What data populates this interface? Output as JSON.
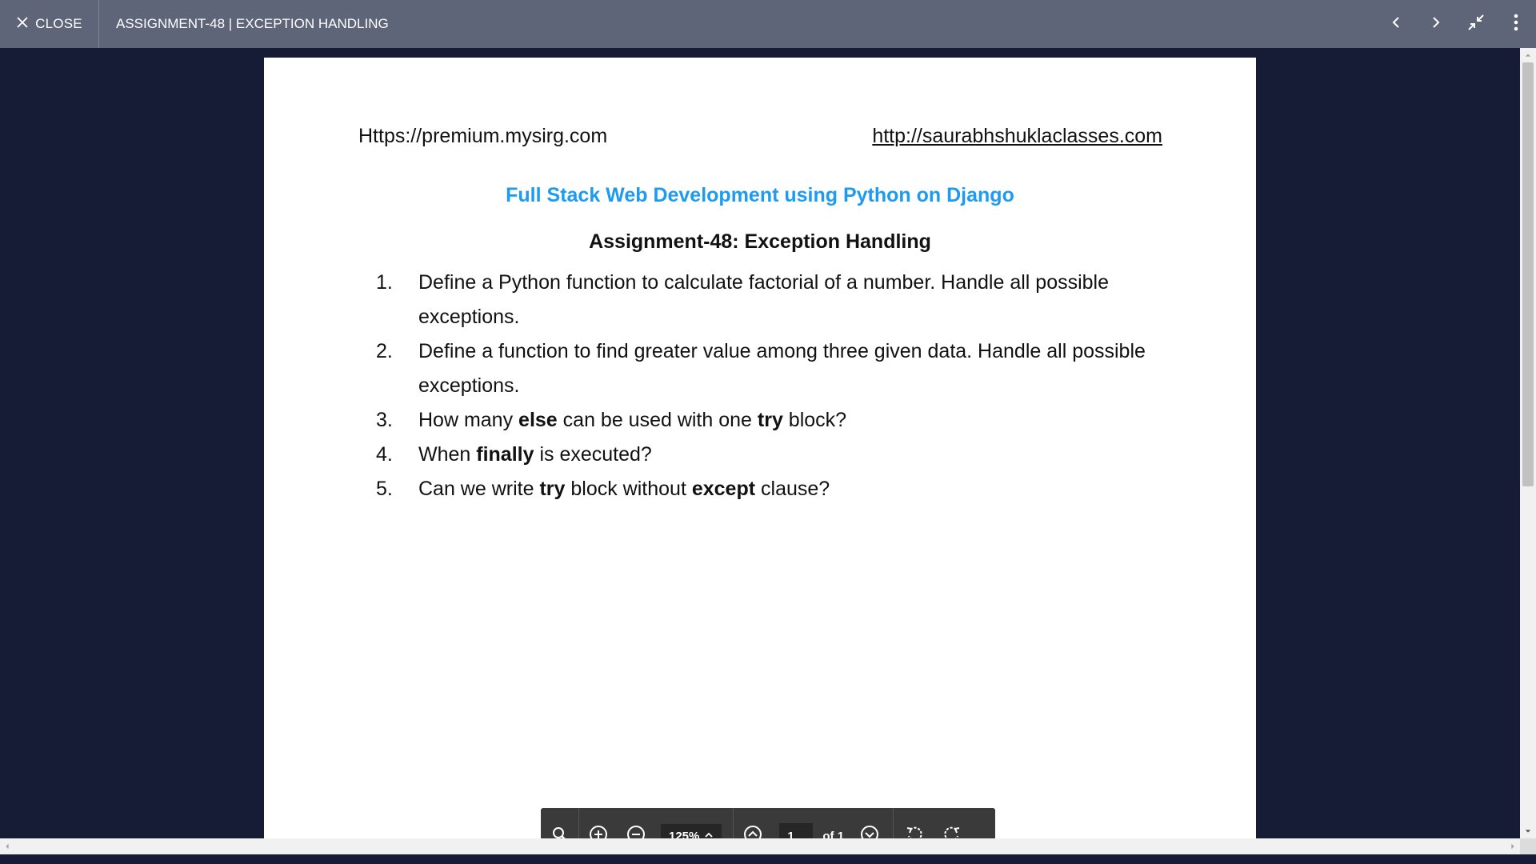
{
  "topbar": {
    "close_label": "CLOSE",
    "title": "ASSIGNMENT-48 | EXCEPTION HANDLING",
    "icons": [
      "chevron-left-icon",
      "chevron-right-icon",
      "minimize-icon",
      "more-vertical-icon"
    ]
  },
  "document": {
    "header_left": "Https://premium.mysirg.com",
    "header_right": "http://saurabhshuklaclasses.com",
    "course_title": "Full Stack Web Development using Python on Django",
    "assignment_title": "Assignment-48: Exception Handling",
    "questions": [
      {
        "num": "1.",
        "parts": [
          {
            "t": "Define a Python function to calculate factorial of a number. Handle all possible exceptions.",
            "b": false
          }
        ]
      },
      {
        "num": "2.",
        "parts": [
          {
            "t": "Define a function to find greater value among three given data. Handle all possible exceptions.",
            "b": false
          }
        ]
      },
      {
        "num": "3.",
        "parts": [
          {
            "t": "How many ",
            "b": false
          },
          {
            "t": "else",
            "b": true
          },
          {
            "t": " can be used with one ",
            "b": false
          },
          {
            "t": "try",
            "b": true
          },
          {
            "t": " block?",
            "b": false
          }
        ]
      },
      {
        "num": "4.",
        "parts": [
          {
            "t": "When ",
            "b": false
          },
          {
            "t": "finally",
            "b": true
          },
          {
            "t": " is executed?",
            "b": false
          }
        ]
      },
      {
        "num": "5.",
        "parts": [
          {
            "t": "Can we write ",
            "b": false
          },
          {
            "t": "try",
            "b": true
          },
          {
            "t": " block without ",
            "b": false
          },
          {
            "t": "except",
            "b": true
          },
          {
            "t": " clause?",
            "b": false
          }
        ]
      }
    ]
  },
  "toolbar": {
    "zoom_level": "125%",
    "page_current": "1",
    "page_total_label": "of 1"
  },
  "colors": {
    "topbar_bg": "#5f6578",
    "viewer_bg": "#171c36",
    "course_title": "#1d9bf0",
    "toolbar_bg": "#3a3a3a"
  }
}
